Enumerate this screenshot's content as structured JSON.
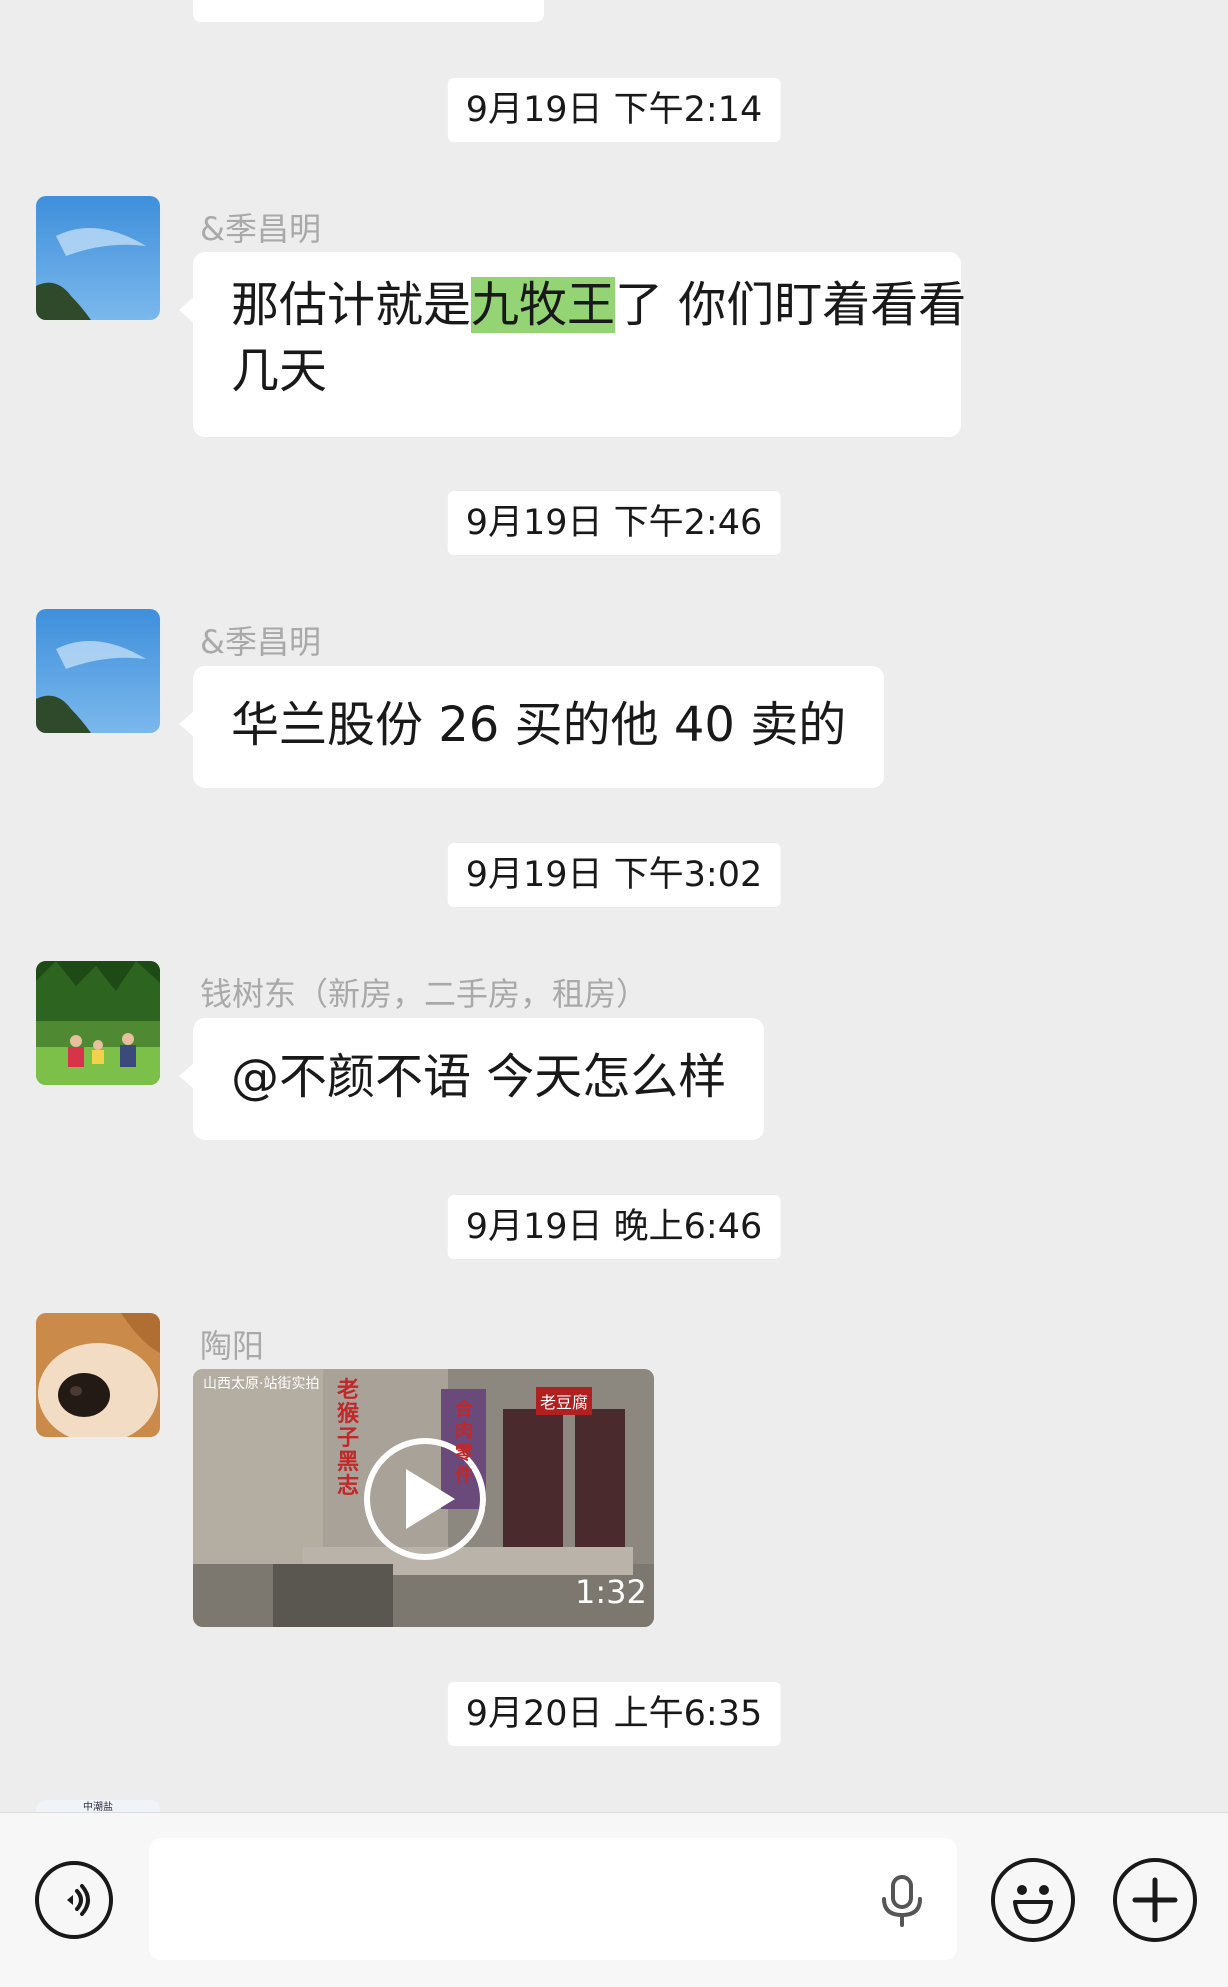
{
  "messages": [
    {
      "timestamp": "9月19日 下午2:14",
      "sender": "&季昌明",
      "avatar": "sky-avatar",
      "text_before": "那估计就是",
      "highlight": "九牧王",
      "text_after_line1": "了  你们盯着看看",
      "text_line2": "几天"
    },
    {
      "timestamp": "9月19日 下午2:46",
      "sender": "&季昌明",
      "avatar": "sky-avatar",
      "text": "华兰股份 26 买的他 40 卖的"
    },
    {
      "timestamp": "9月19日 下午3:02",
      "sender": "钱树东（新房，二手房，租房）",
      "avatar": "garden-family-avatar",
      "text": "@不颜不语  今天怎么样"
    },
    {
      "timestamp": "9月19日 晚上6:46",
      "sender": "陶阳",
      "avatar": "dog-avatar",
      "video": {
        "caption": "山西太原·站街实拍",
        "duration": "1:32",
        "sign_left": "老猴子黑志",
        "sign_mid": "合肉零件",
        "sign_right": "老豆腐"
      }
    }
  ],
  "last_timestamp": "9月20日 上午6:35",
  "partial_avatar_text": "中潮盐",
  "input": {
    "value": ""
  },
  "colors": {
    "background": "#ededed",
    "bubble": "#ffffff",
    "highlight": "#95d475",
    "name": "#a9a9a9"
  },
  "icons": [
    "voice-toggle-icon",
    "microphone-icon",
    "emoji-icon",
    "plus-icon"
  ]
}
